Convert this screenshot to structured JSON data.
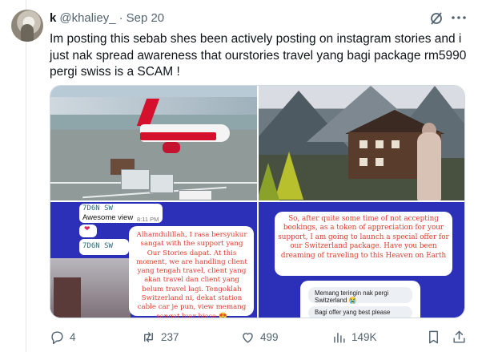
{
  "tweet": {
    "display_name": "k",
    "handle": "@khaliey_",
    "separator": "·",
    "date": "Sep 20",
    "text": "Im posting this sebab shes been actively posting on instagram stories and i just nak spread awareness that ourstories travel yang bagi package rm5990 pergi swiss is a SCAM !"
  },
  "media": {
    "chat": {
      "sender_1": "7D6N SW",
      "message_1": "Awesome view",
      "time_1": "8:11 PM",
      "sender_2": "7D6N SW",
      "heart": "❤",
      "reply_text": "Alhamdulillah, I rasa bersyukur sangat with the support yang Our Stories dapat. At this moment, we are handling client yang tengah travel, client yang akan travel dan client yang belum travel lagi. Tengoklah Switzerland ni, dekat station cable car je pun, view memang sangat luar biasa 😍"
    },
    "offer": {
      "text": "So, after quite some time of not accepting bookings, as a token of appreciation for your support, I am going to launch a special offer for our Switzerland package. Have you been dreaming of traveling to this Heaven on Earth",
      "poll_option_1": "Memang teringin nak pergi Switzerland 😭",
      "poll_option_2": "Bagi offer yang best please"
    }
  },
  "actions": {
    "replies": "4",
    "reposts": "237",
    "likes": "499",
    "views": "149K"
  },
  "icons": {
    "grok": "grok-icon",
    "more": "more-icon",
    "reply": "reply-icon",
    "repost": "repost-icon",
    "like": "heart-icon",
    "views": "views-icon",
    "bookmark": "bookmark-icon",
    "share": "share-icon"
  },
  "colors": {
    "text": "#0f1419",
    "secondary": "#536471",
    "border": "#cfd9de",
    "story_blue": "#2c2fb8",
    "story_red": "#e23a2e"
  }
}
